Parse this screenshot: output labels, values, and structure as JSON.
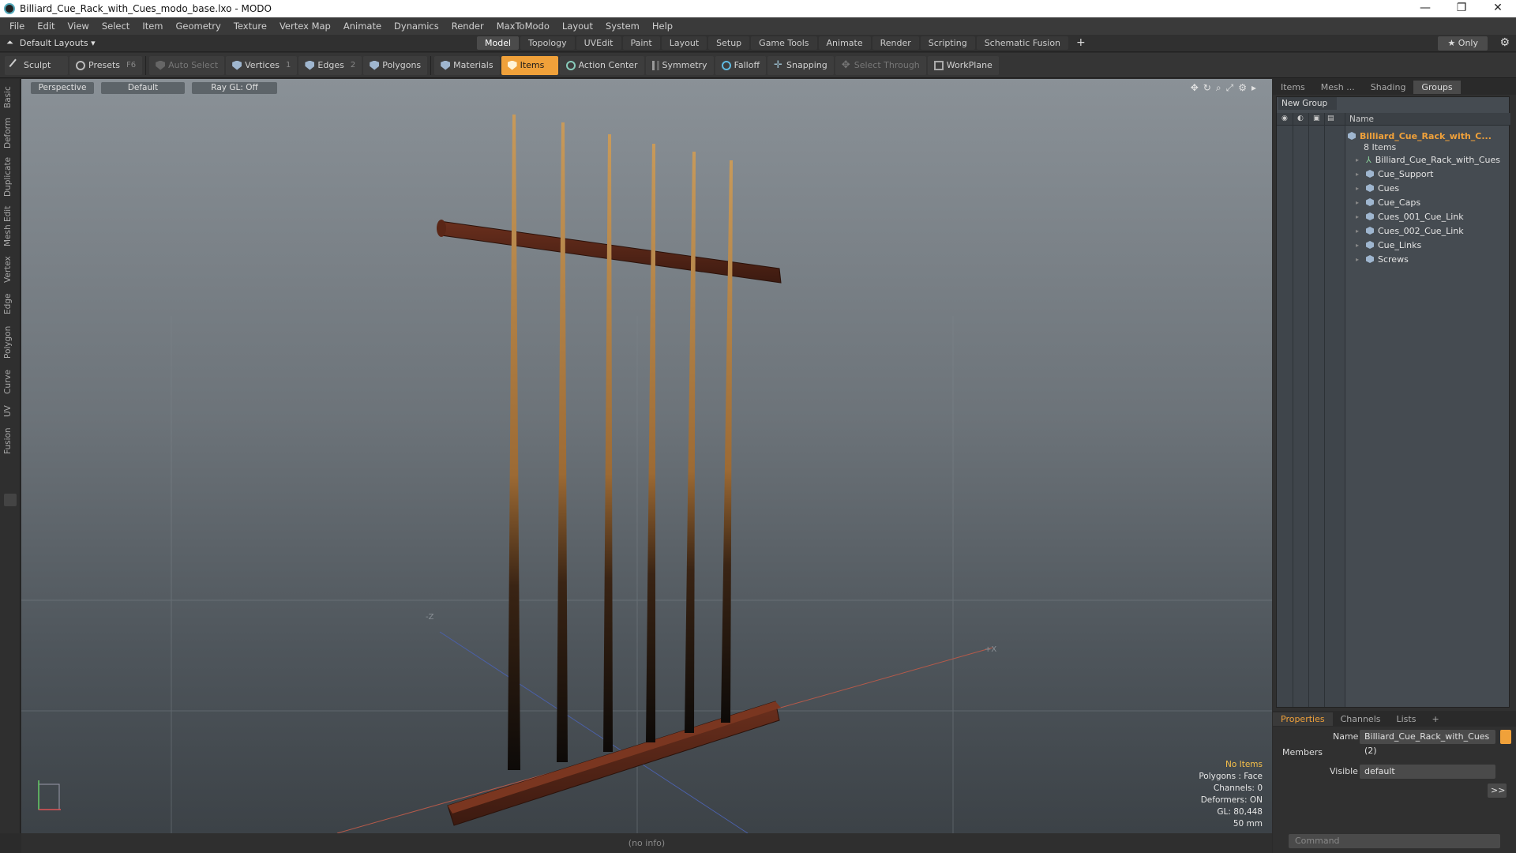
{
  "window": {
    "title": "Billiard_Cue_Rack_with_Cues_modo_base.lxo - MODO",
    "minimize": "—",
    "restore": "❐",
    "close": "✕"
  },
  "menu": [
    "File",
    "Edit",
    "View",
    "Select",
    "Item",
    "Geometry",
    "Texture",
    "Vertex Map",
    "Animate",
    "Dynamics",
    "Render",
    "MaxToModo",
    "Layout",
    "System",
    "Help"
  ],
  "layout_bar": {
    "layouts_label": "Default Layouts ▾",
    "tabs": [
      "Model",
      "Topology",
      "UVEdit",
      "Paint",
      "Layout",
      "Setup",
      "Game Tools",
      "Animate",
      "Render",
      "Scripting",
      "Schematic Fusion"
    ],
    "active_tab": "Model",
    "add": "+",
    "only": "★  Only",
    "settings": "⚙"
  },
  "toolbar": {
    "sculpt": "Sculpt",
    "presets": "Presets",
    "presets_key": "F6",
    "auto_select": "Auto Select",
    "vertices": "Vertices",
    "vertices_count": "1",
    "edges": "Edges",
    "edges_count": "2",
    "polygons": "Polygons",
    "materials": "Materials",
    "items": "Items",
    "action_center": "Action Center",
    "symmetry": "Symmetry",
    "falloff": "Falloff",
    "snapping": "Snapping",
    "select_through": "Select Through",
    "workplane": "WorkPlane"
  },
  "left_tabs": [
    "Basic",
    "Deform",
    "Duplicate",
    "Mesh Edit",
    "Vertex",
    "Edge",
    "Polygon",
    "Curve",
    "UV",
    "Fusion"
  ],
  "viewport": {
    "view": "Perspective",
    "shading": "Default",
    "raygl": "Ray GL: Off",
    "info": {
      "items": "No Items",
      "polygons": "Polygons : Face",
      "channels": "Channels: 0",
      "deformers": "Deformers: ON",
      "gl": "GL: 80,448",
      "scale": "50 mm"
    },
    "axis_z": "-Z",
    "axis_x": "+X"
  },
  "status": "(no info)",
  "right_panel": {
    "tabs": [
      "Items",
      "Mesh ...",
      "Shading",
      "Groups"
    ],
    "active_tab": "Groups",
    "new_group": "New Group",
    "name_header": "Name",
    "group_name": "Billiard_Cue_Rack_with_C...",
    "group_count": "8 Items",
    "items": [
      "Billiard_Cue_Rack_with_Cues",
      "Cue_Support",
      "Cues",
      "Cue_Caps",
      "Cues_001_Cue_Link",
      "Cues_002_Cue_Link",
      "Cue_Links",
      "Screws"
    ]
  },
  "properties": {
    "tabs": [
      "Properties",
      "Channels",
      "Lists",
      "+"
    ],
    "active_tab": "Properties",
    "name_label": "Name",
    "name_value": "Billiard_Cue_Rack_with_Cues (2)",
    "members": "Members",
    "visible_label": "Visible",
    "visible_value": "default",
    "more": ">>",
    "command_placeholder": "Command"
  },
  "colors": {
    "accent": "#f0a13a",
    "group_name": "#f0a13a"
  }
}
